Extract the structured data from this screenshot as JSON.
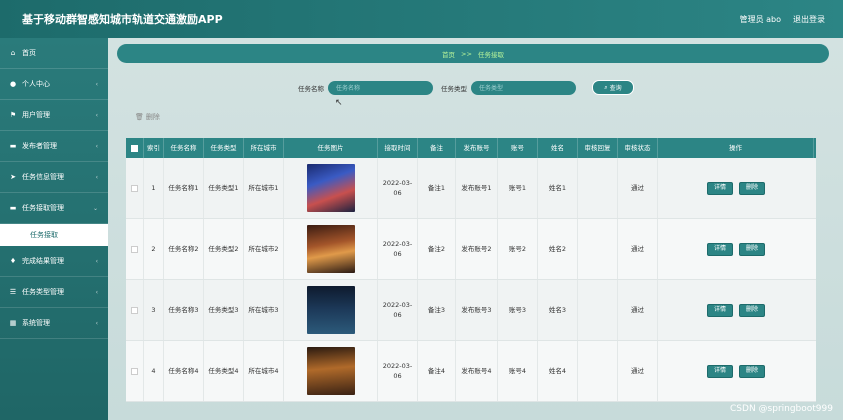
{
  "app": {
    "title": "基于移动群智感知城市轨道交通激励APP"
  },
  "topbar": {
    "user": "管理员 abo",
    "logout": "退出登录"
  },
  "sidebar": {
    "items": [
      {
        "icon": "home-icon",
        "label": "首页"
      },
      {
        "icon": "person-icon",
        "label": "个人中心"
      },
      {
        "icon": "flag-icon",
        "label": "用户管理"
      },
      {
        "icon": "doc-icon",
        "label": "发布者管理"
      },
      {
        "icon": "send-icon",
        "label": "任务信息管理"
      },
      {
        "icon": "doc-icon",
        "label": "任务接取管理"
      },
      {
        "icon": "pin-icon",
        "label": "完成结果管理"
      },
      {
        "icon": "list-icon",
        "label": "任务类型管理"
      },
      {
        "icon": "grid-icon",
        "label": "系统管理"
      }
    ],
    "active_sub": "任务接取"
  },
  "breadcrumb": {
    "home": "首页",
    "sep": ">>",
    "current": "任务接取"
  },
  "search": {
    "name_label": "任务名称",
    "name_placeholder": "任务名称",
    "type_label": "任务类型",
    "type_placeholder": "任务类型",
    "button": "查询"
  },
  "delete_label": "删除",
  "table": {
    "headers": [
      "索引",
      "任务名称",
      "任务类型",
      "所在城市",
      "任务图片",
      "接取时间",
      "备注",
      "发布账号",
      "账号",
      "姓名",
      "审核回复",
      "审核状态",
      "操作"
    ],
    "rows": [
      {
        "idx": "1",
        "name": "任务名称1",
        "type": "任务类型1",
        "city": "所在城市1",
        "time": "2022-03-06",
        "note": "备注1",
        "pub": "发布账号1",
        "acc": "账号1",
        "nm": "姓名1",
        "reply": "",
        "status": "通过"
      },
      {
        "idx": "2",
        "name": "任务名称2",
        "type": "任务类型2",
        "city": "所在城市2",
        "time": "2022-03-06",
        "note": "备注2",
        "pub": "发布账号2",
        "acc": "账号2",
        "nm": "姓名2",
        "reply": "",
        "status": "通过"
      },
      {
        "idx": "3",
        "name": "任务名称3",
        "type": "任务类型3",
        "city": "所在城市3",
        "time": "2022-03-06",
        "note": "备注3",
        "pub": "发布账号3",
        "acc": "账号3",
        "nm": "姓名3",
        "reply": "",
        "status": "通过"
      },
      {
        "idx": "4",
        "name": "任务名称4",
        "type": "任务类型4",
        "city": "所在城市4",
        "time": "2022-03-06",
        "note": "备注4",
        "pub": "发布账号4",
        "acc": "账号4",
        "nm": "姓名4",
        "reply": "",
        "status": "通过"
      }
    ],
    "detail_btn": "详情",
    "delete_btn": "删除"
  },
  "watermark": "CSDN @springboot999"
}
